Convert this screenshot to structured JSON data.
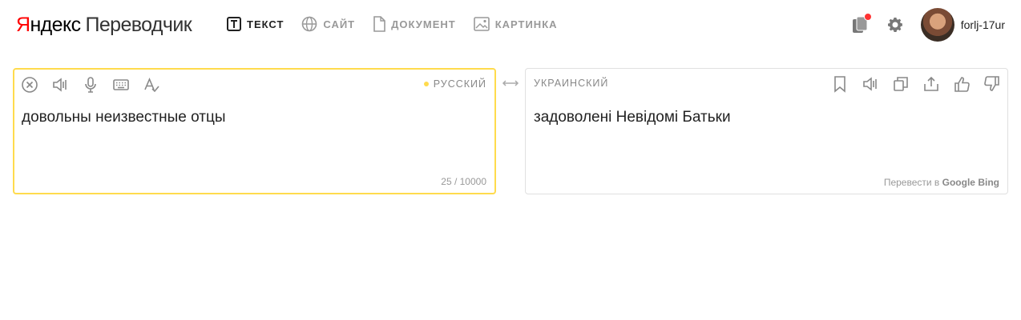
{
  "logo": {
    "yandex_first": "Я",
    "yandex_rest": "ндекс",
    "product": "Переводчик"
  },
  "tabs": [
    {
      "label": "ТЕКСТ",
      "icon": "text-icon"
    },
    {
      "label": "САЙТ",
      "icon": "globe-icon"
    },
    {
      "label": "ДОКУМЕНТ",
      "icon": "document-icon"
    },
    {
      "label": "КАРТИНКА",
      "icon": "image-icon"
    }
  ],
  "user": {
    "name": "forlj-17ur"
  },
  "source": {
    "language": "РУССКИЙ",
    "text": "довольны неизвестные отцы",
    "counter": "25 / 10000"
  },
  "target": {
    "language": "УКРАИНСКИЙ",
    "text": "задоволені Невідомі Батьки",
    "engine_prefix": "Перевести в",
    "engines": [
      "Google",
      "Bing"
    ]
  },
  "colors": {
    "accent": "#ffdb4d",
    "logo_red": "#ff0000",
    "notification": "#ff3333"
  }
}
